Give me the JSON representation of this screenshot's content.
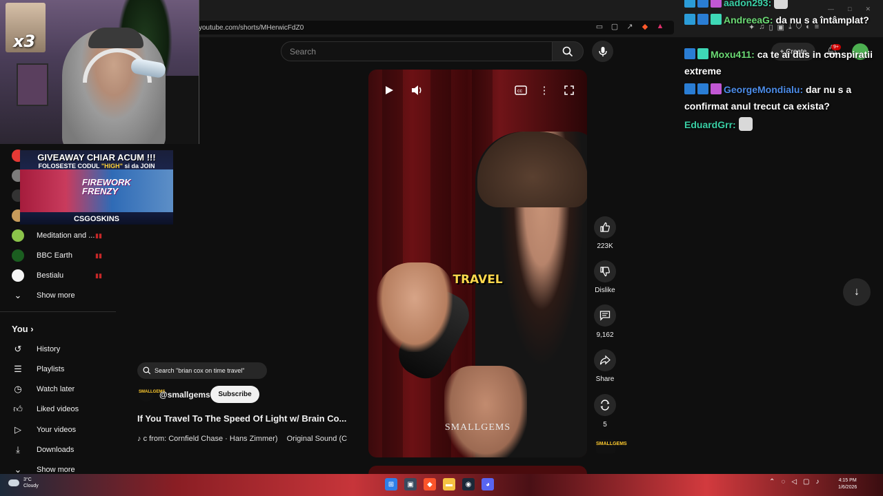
{
  "browser": {
    "url": "youtube.com/shorts/MHerwicFdZ0"
  },
  "search": {
    "placeholder": "Search"
  },
  "header": {
    "create_label": "Create",
    "notif_count": "9+"
  },
  "stream_overlay": {
    "multiplier": "x3",
    "giveaway_title": "GIVEAWAY CHIAR ACUM !!!",
    "giveaway_sub_prefix": "FOLOSESTE CODUL",
    "giveaway_code": "\"HIGH\"",
    "giveaway_sub_suffix": "si da JOIN",
    "giveaway_art_text_1": "FIREWORK",
    "giveaway_art_text_2": "FRENZY",
    "giveaway_brand": "CSGOSKINS"
  },
  "sidebar": {
    "subscriptions": [
      {
        "name": "Meditation and ...",
        "color": "#8bc34a"
      },
      {
        "name": "BBC Earth",
        "color": "#1b5e20"
      },
      {
        "name": "Bestialu",
        "color": "#f5f5f5"
      }
    ],
    "show_more": "Show more",
    "you_label": "You",
    "you_items": [
      {
        "label": "History",
        "icon": "history-icon"
      },
      {
        "label": "Playlists",
        "icon": "playlists-icon"
      },
      {
        "label": "Watch later",
        "icon": "watch-later-icon"
      },
      {
        "label": "Liked videos",
        "icon": "liked-icon"
      },
      {
        "label": "Your videos",
        "icon": "your-videos-icon"
      },
      {
        "label": "Downloads",
        "icon": "downloads-icon"
      }
    ],
    "show_more_2": "Show more"
  },
  "video": {
    "caption": "TRAVEL",
    "watermark": "SMALLGEMS"
  },
  "actions": {
    "likes": "223K",
    "dislike_label": "Dislike",
    "comments": "9,162",
    "share_label": "Share",
    "remix_count": "5"
  },
  "info": {
    "search_chip": "Search \"brian cox on time travel\"",
    "channel_handle": "@smallgems",
    "subscribe_label": "Subscribe",
    "title": "If You Travel To The Speed Of Light w/ Brain Co...",
    "music": "c from: Cornfield Chase · Hans Zimmer)",
    "original_sound": "Original Sound (C"
  },
  "chat": [
    {
      "user": "aadon293:",
      "message": "",
      "name_color": "#3ad0a6"
    },
    {
      "user": "AndreeaG:",
      "message": "da nu s a întâmplat?",
      "name_color": "#6bda74"
    },
    {
      "user": "Moxu411:",
      "message": "ca te ai dus in conspiratii extreme",
      "name_color": "#6bda74"
    },
    {
      "user": "GeorgeMondialu:",
      "message": "dar nu s a confirmat anul trecut ca exista?",
      "name_color": "#4c8ce8"
    },
    {
      "user": "EduardGrr:",
      "message": "",
      "name_color": "#3ad0a6"
    }
  ],
  "taskbar": {
    "temperature": "3°C",
    "condition": "Cloudy",
    "time": "4:15 PM",
    "date": "1/6/2026"
  }
}
